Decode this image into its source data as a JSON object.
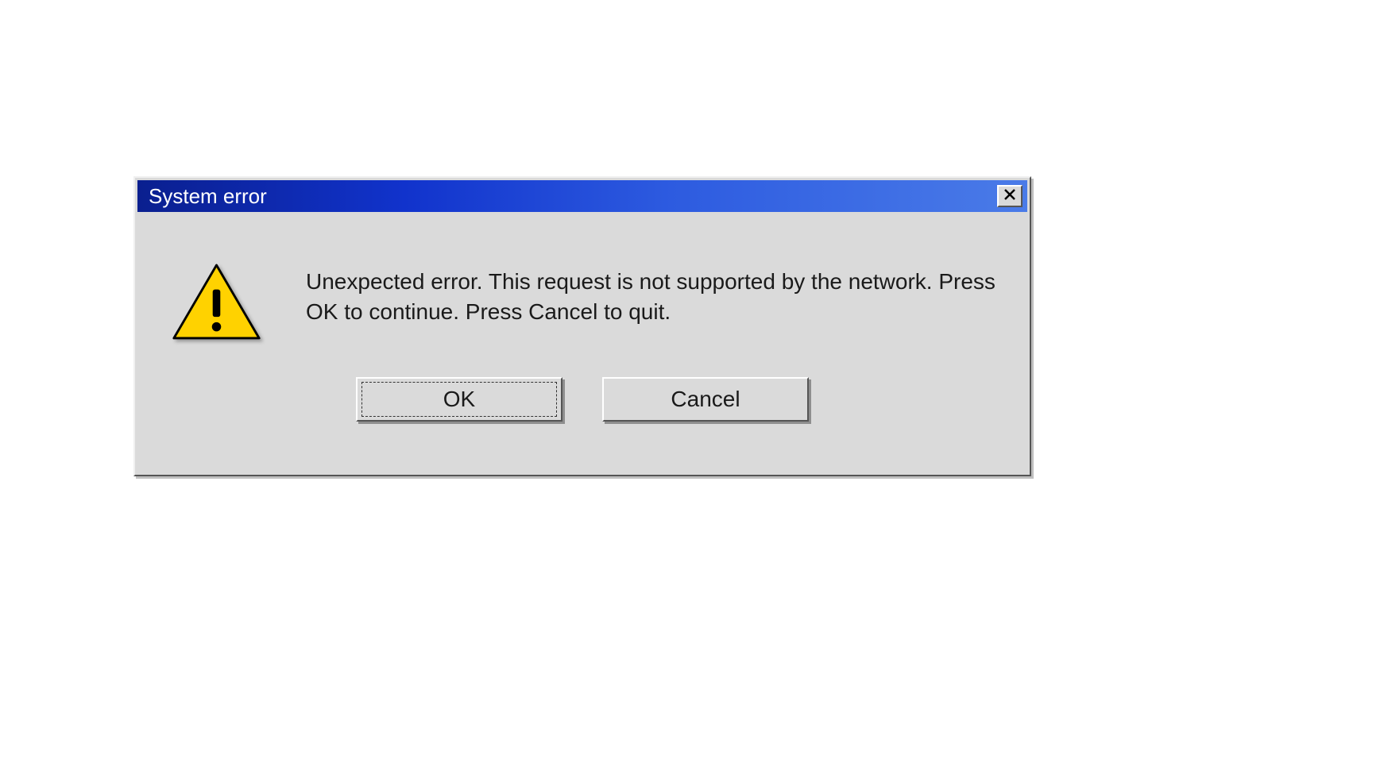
{
  "dialog": {
    "title": "System error",
    "message": "Unexpected error. This request is not supported by the network. Press OK to continue. Press Cancel to quit.",
    "buttons": {
      "ok": "OK",
      "cancel": "Cancel"
    },
    "icon": "warning-triangle",
    "colors": {
      "titlebar_start": "#0a1f8f",
      "titlebar_end": "#4a7be8",
      "window_bg": "#dadada",
      "warning_fill": "#ffd200"
    }
  }
}
